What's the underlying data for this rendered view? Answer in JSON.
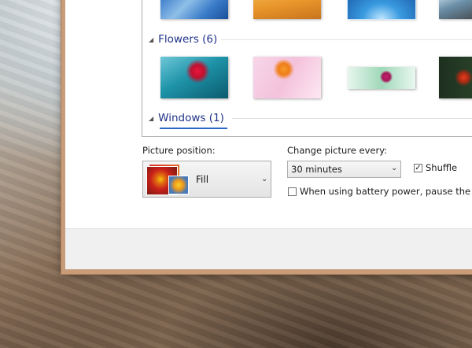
{
  "groups": [
    {
      "label": "Flowers (6)"
    },
    {
      "label": "Windows (1)"
    }
  ],
  "picture_position": {
    "label": "Picture position:",
    "value": "Fill"
  },
  "change_picture": {
    "label": "Change picture every:",
    "value": "30 minutes"
  },
  "shuffle": {
    "label": "Shuffle",
    "checked": true
  },
  "battery": {
    "label": "When using battery power, pause the slide",
    "checked": false
  },
  "colors": {
    "group_header": "#1e3287",
    "window_border": "#c89c78"
  }
}
